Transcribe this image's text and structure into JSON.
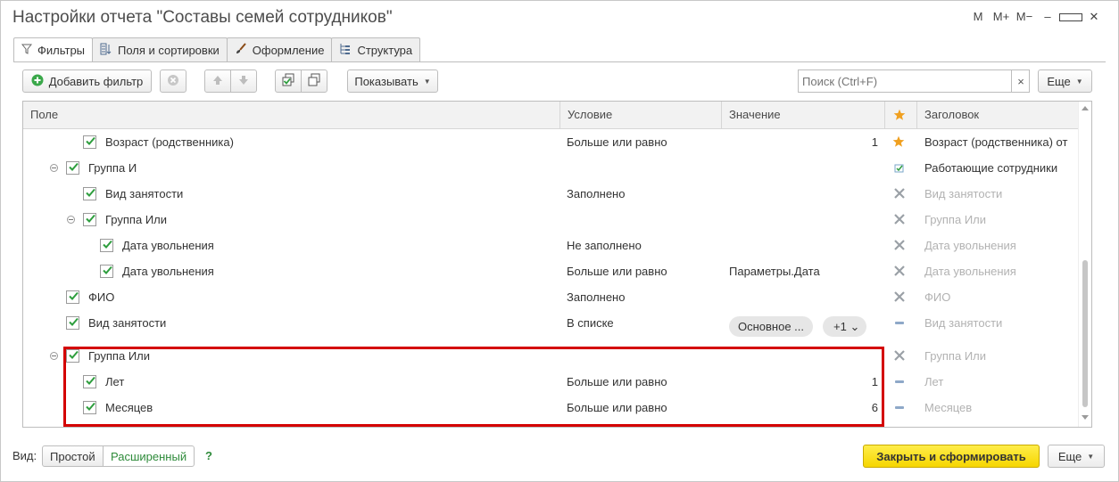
{
  "window": {
    "title": "Настройки отчета \"Составы семей сотрудников\"",
    "controls": [
      "M",
      "M+",
      "M−",
      "–"
    ]
  },
  "tabs": [
    {
      "label": "Фильтры",
      "icon": "filter-icon",
      "active": true
    },
    {
      "label": "Поля и сортировки",
      "icon": "fields-sort-icon",
      "active": false
    },
    {
      "label": "Оформление",
      "icon": "brush-icon",
      "active": false
    },
    {
      "label": "Структура",
      "icon": "structure-icon",
      "active": false
    }
  ],
  "toolbar": {
    "add_filter": "Добавить фильтр",
    "show": "Показывать",
    "search_placeholder": "Поиск (Ctrl+F)",
    "more": "Еще",
    "search_clear": "×"
  },
  "columns": {
    "field": "Поле",
    "condition": "Условие",
    "value": "Значение",
    "header": "Заголовок"
  },
  "rows": [
    {
      "field": "Возраст (родственника)",
      "condition": "Больше или равно",
      "value": "1",
      "header": "Возраст (родственника) от",
      "mark": "star"
    },
    {
      "field": "Группа И",
      "condition": "",
      "value": "",
      "header": "Работающие сотрудники",
      "mark": "edit"
    },
    {
      "field": "Вид занятости",
      "condition": "Заполнено",
      "value": "",
      "header": "Вид занятости",
      "mark": "x"
    },
    {
      "field": "Группа Или",
      "condition": "",
      "value": "",
      "header": "Группа Или",
      "mark": "x"
    },
    {
      "field": "Дата увольнения",
      "condition": "Не заполнено",
      "value": "",
      "header": "Дата увольнения",
      "mark": "x"
    },
    {
      "field": "Дата увольнения",
      "condition": "Больше или равно",
      "value": "Параметры.Дата",
      "header": "Дата увольнения",
      "mark": "x"
    },
    {
      "field": "ФИО",
      "condition": "Заполнено",
      "value": "",
      "header": "ФИО",
      "mark": "x"
    },
    {
      "field": "Вид занятости",
      "condition": "В списке",
      "value": "Основное ...",
      "value_extra": "+1",
      "header": "Вид занятости",
      "mark": "dash"
    },
    {
      "field": "Группа Или",
      "condition": "",
      "value": "",
      "header": "Группа Или",
      "mark": "x"
    },
    {
      "field": "Лет",
      "condition": "Больше или равно",
      "value": "1",
      "header": "Лет",
      "mark": "dash"
    },
    {
      "field": "Месяцев",
      "condition": "Больше или равно",
      "value": "6",
      "header": "Месяцев",
      "mark": "dash"
    }
  ],
  "bottom": {
    "view_label": "Вид:",
    "simple": "Простой",
    "extended": "Расширенный",
    "help": "?",
    "close_and_run": "Закрыть и сформировать",
    "more": "Еще"
  },
  "colors": {
    "accent_yellow": "#f6d600",
    "check_green": "#2e9e3e",
    "highlight_red": "#d40000",
    "star_orange": "#f0a020"
  }
}
